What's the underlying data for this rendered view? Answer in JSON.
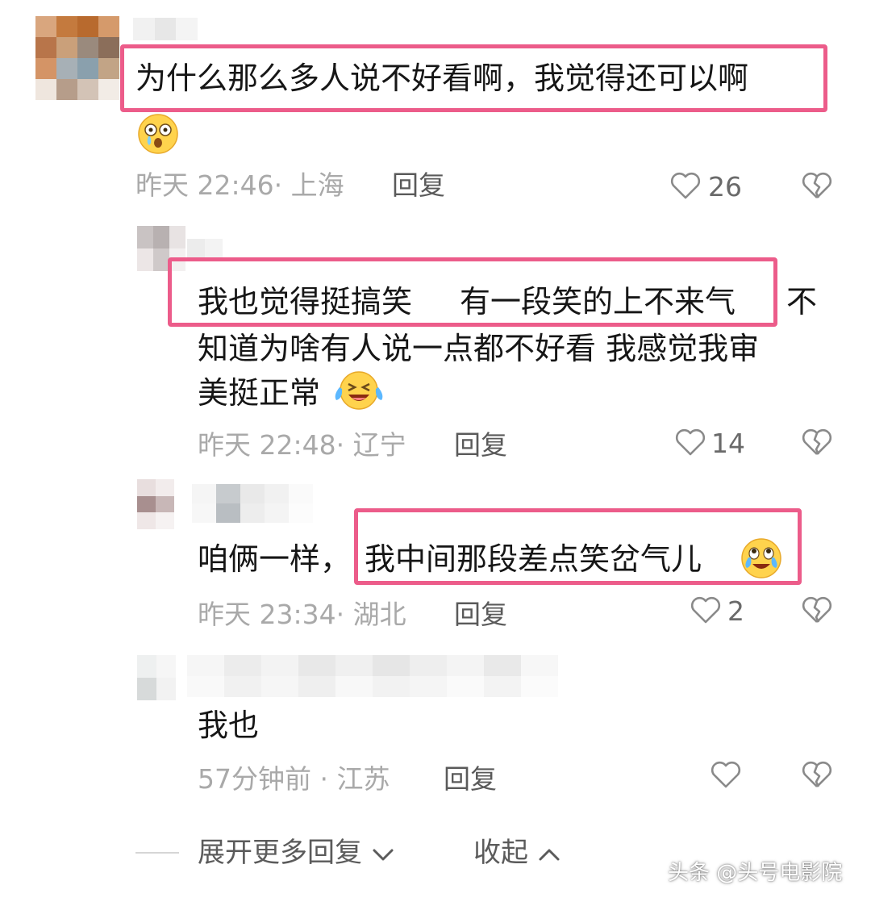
{
  "comments": [
    {
      "text_line1": "为什么那么多人说不好看啊，我觉得还可以啊",
      "emoji": "astonished-tear-emoji",
      "time_location": "昨天 22:46· 上海",
      "reply_label": "回复",
      "likes": "26"
    },
    {
      "text_line1a": "我也觉得挺搞笑",
      "text_line1b": "有一段笑的上不来气",
      "text_line1c": "不",
      "text_line2": "知道为啥有人说一点都不好看 我感觉我审",
      "text_line3": "美挺正常",
      "emoji": "laughing-tears-emoji",
      "time_location": "昨天 22:48· 辽宁",
      "reply_label": "回复",
      "likes": "14"
    },
    {
      "text_prefix": "咱俩一样，",
      "text_highlight": "我中间那段差点笑岔气儿",
      "emoji": "crying-laughing-emoji",
      "time_location": "昨天 23:34· 湖北",
      "reply_label": "回复",
      "likes": "2"
    },
    {
      "text": "我也",
      "time_location": "57分钟前 · 江苏",
      "reply_label": "回复",
      "likes": ""
    }
  ],
  "footer": {
    "expand_label": "展开更多回复",
    "collapse_label": "收起"
  },
  "watermark": "头条 @头号电影院",
  "colors": {
    "highlight_border": "#ec5c8a",
    "meta_text": "#a9a9a9",
    "body_text": "#161616"
  }
}
